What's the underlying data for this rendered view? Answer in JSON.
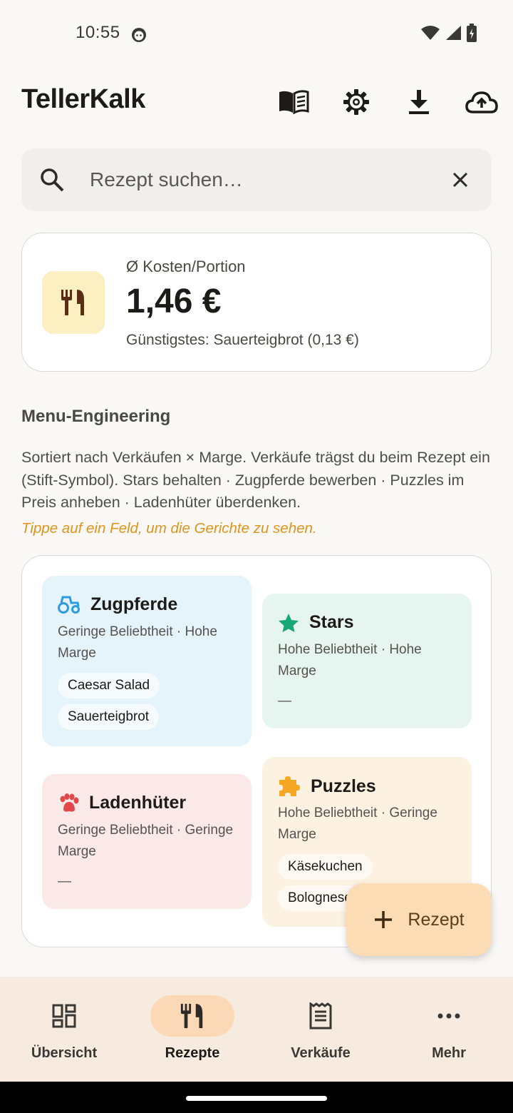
{
  "status": {
    "time": "10:55"
  },
  "app": {
    "title": "TellerKalk"
  },
  "search": {
    "placeholder": "Rezept suchen…"
  },
  "cost_card": {
    "label": "Ø Kosten/Portion",
    "value": "1,46 €",
    "cheapest": "Günstigstes: Sauerteigbrot (0,13 €)"
  },
  "menu_engineering": {
    "title": "Menu-Engineering",
    "description": "Sortiert nach Verkäufen × Marge. Verkäufe trägst du beim Rezept ein (Stift-Symbol). Stars behalten · Zugpferde bewerben · Puzzles im Preis anheben · Ladenhüter überdenken.",
    "hint": "Tippe auf ein Feld, um die Gerichte zu sehen.",
    "quadrants": {
      "zugpferde": {
        "title": "Zugpferde",
        "desc": "Geringe Beliebtheit · Hohe Marge",
        "items": [
          "Caesar Salad",
          "Sauerteigbrot"
        ],
        "color": "#e5f3fb"
      },
      "stars": {
        "title": "Stars",
        "desc": "Hohe Beliebtheit · Hohe Marge",
        "empty": "—",
        "color": "#e6f5ef"
      },
      "ladenhueter": {
        "title": "Ladenhüter",
        "desc": "Geringe Beliebtheit · Geringe Marge",
        "empty": "—",
        "color": "#fbe9e8"
      },
      "puzzles": {
        "title": "Puzzles",
        "desc": "Hohe Beliebtheit · Geringe Marge",
        "items": [
          "Käsekuchen",
          "Bolognese"
        ],
        "color": "#fdf2e2"
      }
    }
  },
  "fab": {
    "label": "Rezept"
  },
  "nav": [
    {
      "label": "Übersicht",
      "icon": "dashboard-icon"
    },
    {
      "label": "Rezepte",
      "icon": "restaurant-icon",
      "active": true
    },
    {
      "label": "Verkäufe",
      "icon": "receipt-icon"
    },
    {
      "label": "Mehr",
      "icon": "more-icon"
    }
  ]
}
